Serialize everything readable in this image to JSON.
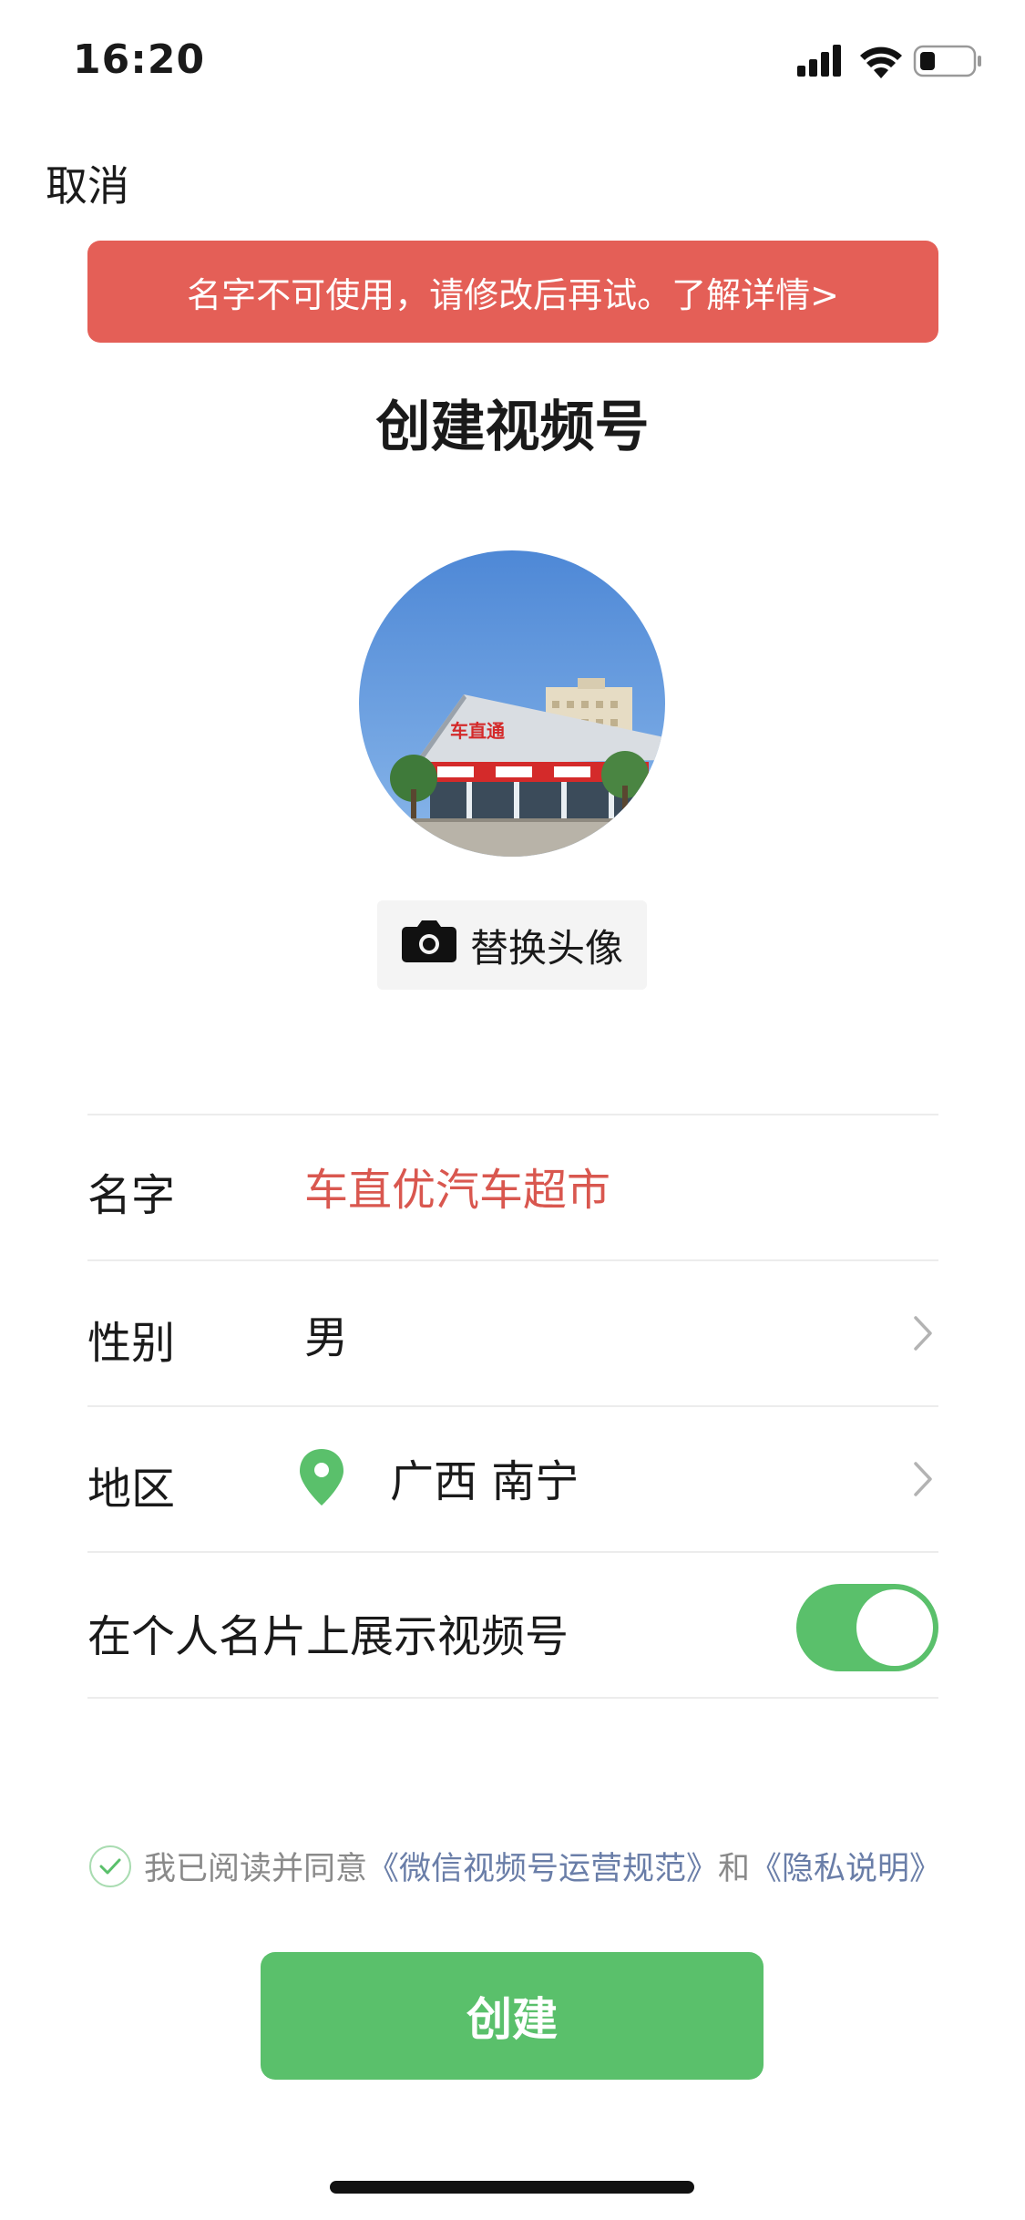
{
  "status_bar": {
    "time": "16:20"
  },
  "nav": {
    "cancel_label": "取消"
  },
  "error_banner": {
    "text": "名字不可使用，请修改后再试。了解详情>"
  },
  "page": {
    "title": "创建视频号"
  },
  "avatar": {
    "replace_label": "替换头像",
    "sign_text": "车直通"
  },
  "form": {
    "name": {
      "label": "名字",
      "value": "车直优汽车超市"
    },
    "gender": {
      "label": "性别",
      "value": "男"
    },
    "region": {
      "label": "地区",
      "value": "广西 南宁"
    },
    "show_on_card": {
      "label": "在个人名片上展示视频号",
      "enabled": true
    }
  },
  "agreement": {
    "prefix": "我已阅读并同意",
    "link1": "《微信视频号运营规范》",
    "middle": "和",
    "link2": "《隐私说明》",
    "checked": true
  },
  "actions": {
    "create_label": "创建"
  },
  "colors": {
    "accent_green": "#5ac06b",
    "error_red": "#e45f57",
    "name_error_text": "#d9574f",
    "link_color": "#6a7ea8"
  },
  "icons": {
    "camera": "camera-icon",
    "location": "location-pin-icon",
    "chevron": "chevron-right-icon",
    "check": "check-icon"
  }
}
